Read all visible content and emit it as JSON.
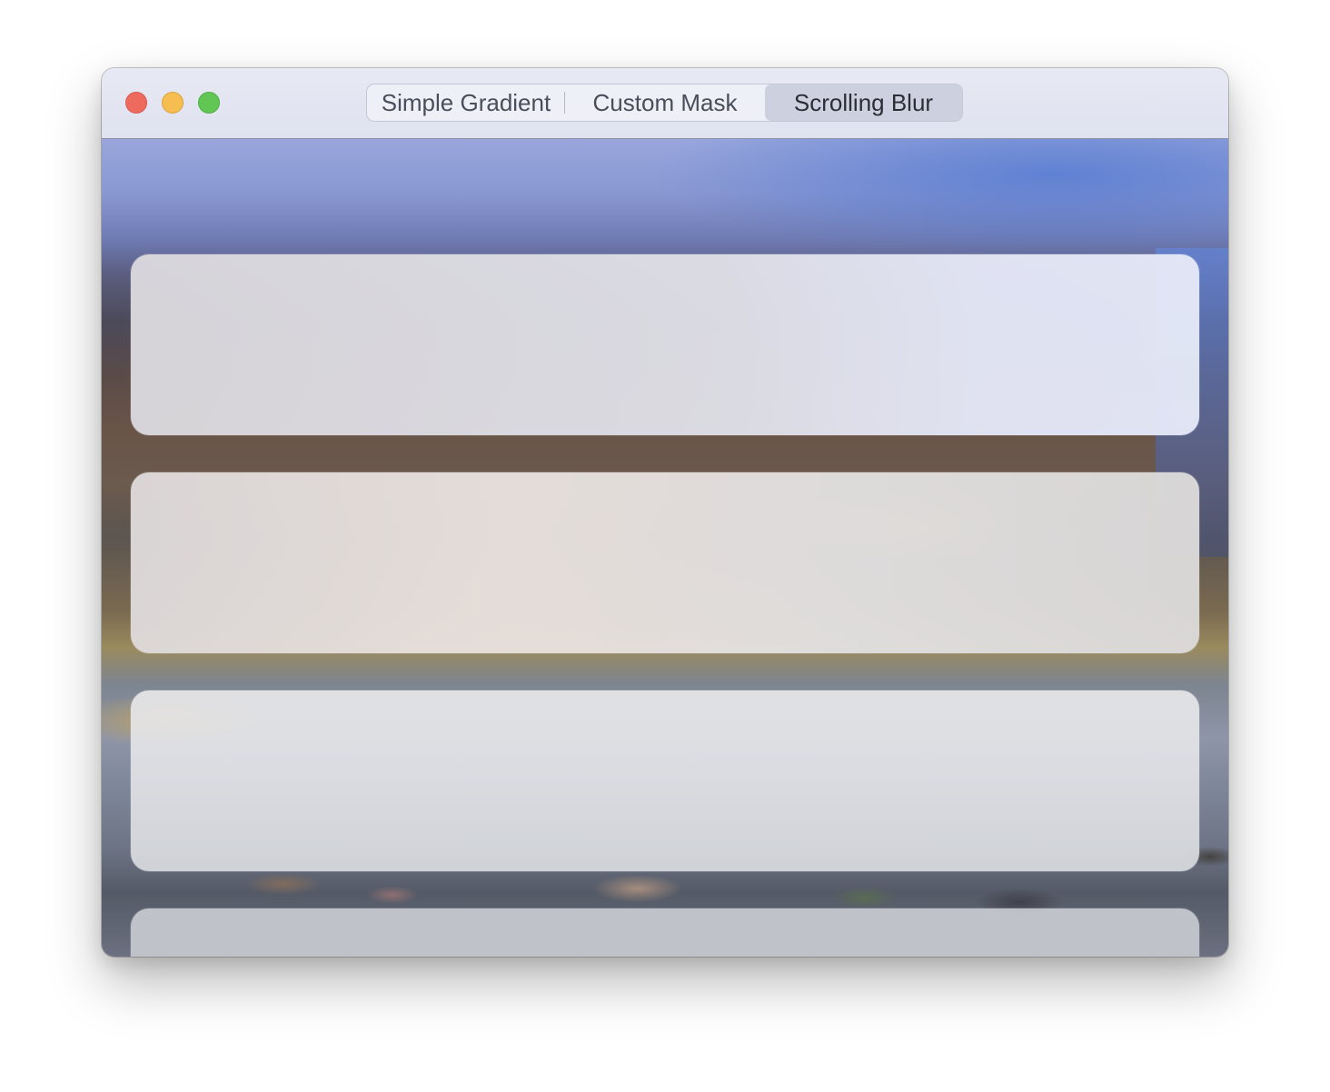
{
  "window": {
    "controls": [
      "close",
      "minimize",
      "zoom"
    ]
  },
  "segmented_control": {
    "selected": "Scrolling Blur",
    "segments": [
      "Simple Gradient",
      "Custom Mask",
      "Scrolling Blur"
    ]
  },
  "colors": {
    "close": "#ee6a5e",
    "minimize": "#f6be50",
    "zoom": "#62c655",
    "selected_segment": "#cdd0de"
  },
  "content": {
    "cards_visible": 4
  }
}
